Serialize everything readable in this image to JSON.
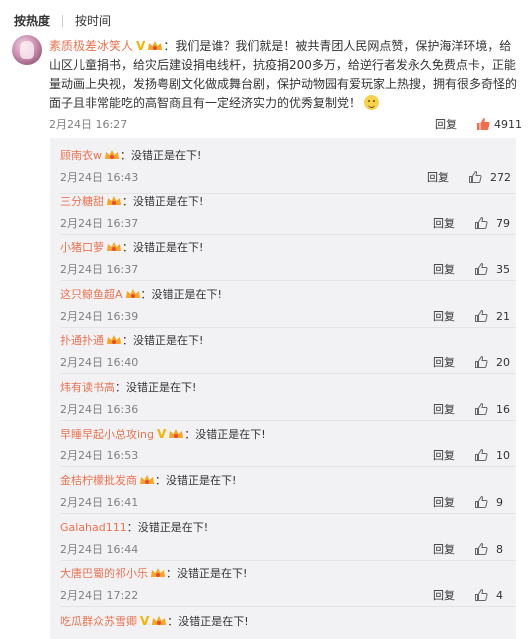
{
  "tabs": {
    "hot": "按热度",
    "time": "按时间"
  },
  "main_comment": {
    "username": "素质极差冰笑人",
    "text": "：我们是谁？我们就是！被共青团人民网点赞，保护海洋环境，给山区儿童捐书，给灾后建设捐电线杆，抗疫捐200多万，给逆行者发永久免费点卡，正能量动画上央视，发扬粤剧文化做成舞台剧，保护动物园有爱玩家上热搜，拥有很多奇怪的面子且非常能吃的高智商且有一定经济实力的优秀复制党！",
    "time": "2月24日 16:27",
    "reply_label": "回复",
    "likes": "4911"
  },
  "replies": [
    {
      "username": "顾南衣w",
      "text": "：没错正是在下!",
      "time": "2月24日 16:43",
      "reply_label": "回复",
      "likes": "272",
      "badges": [
        "crown"
      ]
    },
    {
      "username": "三分糖甜",
      "text": "：没错正是在下!",
      "time": "2月24日 16:37",
      "reply_label": "回复",
      "likes": "79",
      "badges": [
        "crown"
      ]
    },
    {
      "username": "小猪口萝",
      "text": "：没错正是在下!",
      "time": "2月24日 16:37",
      "reply_label": "回复",
      "likes": "35",
      "badges": [
        "crown"
      ]
    },
    {
      "username": "这只鲸鱼超A",
      "text": "：没错正是在下!",
      "time": "2月24日 16:39",
      "reply_label": "回复",
      "likes": "21",
      "badges": [
        "crown"
      ]
    },
    {
      "username": "扑通扑通",
      "text": "：没错正是在下!",
      "time": "2月24日 16:40",
      "reply_label": "回复",
      "likes": "20",
      "badges": [
        "crown"
      ]
    },
    {
      "username": "炜有读书高",
      "text": "：没错正是在下!",
      "time": "2月24日 16:36",
      "reply_label": "回复",
      "likes": "16",
      "badges": []
    },
    {
      "username": "早睡早起小总攻ing",
      "text": "：没错正是在下!",
      "time": "2月24日 16:53",
      "reply_label": "回复",
      "likes": "10",
      "badges": [
        "v",
        "crown"
      ]
    },
    {
      "username": "金桔柠檬批发商",
      "text": "：没错正是在下!",
      "time": "2月24日 16:41",
      "reply_label": "回复",
      "likes": "9",
      "badges": [
        "crown"
      ]
    },
    {
      "username": "Galahad111",
      "text": "：没错正是在下!",
      "time": "2月24日 16:44",
      "reply_label": "回复",
      "likes": "8",
      "badges": []
    },
    {
      "username": "大唐巴蜀的祁小乐",
      "text": "：没错正是在下!",
      "time": "2月24日 17:22",
      "reply_label": "回复",
      "likes": "4",
      "badges": [
        "crown"
      ]
    },
    {
      "username": "吃瓜群众苏雪卿",
      "text": "：没错正是在下!",
      "time": "",
      "reply_label": "",
      "likes": "",
      "badges": [
        "v",
        "crown"
      ]
    }
  ],
  "colors": {
    "username": "#eb7350",
    "liked": "#f56c4d",
    "reply_bg": "#f2f2f5"
  }
}
